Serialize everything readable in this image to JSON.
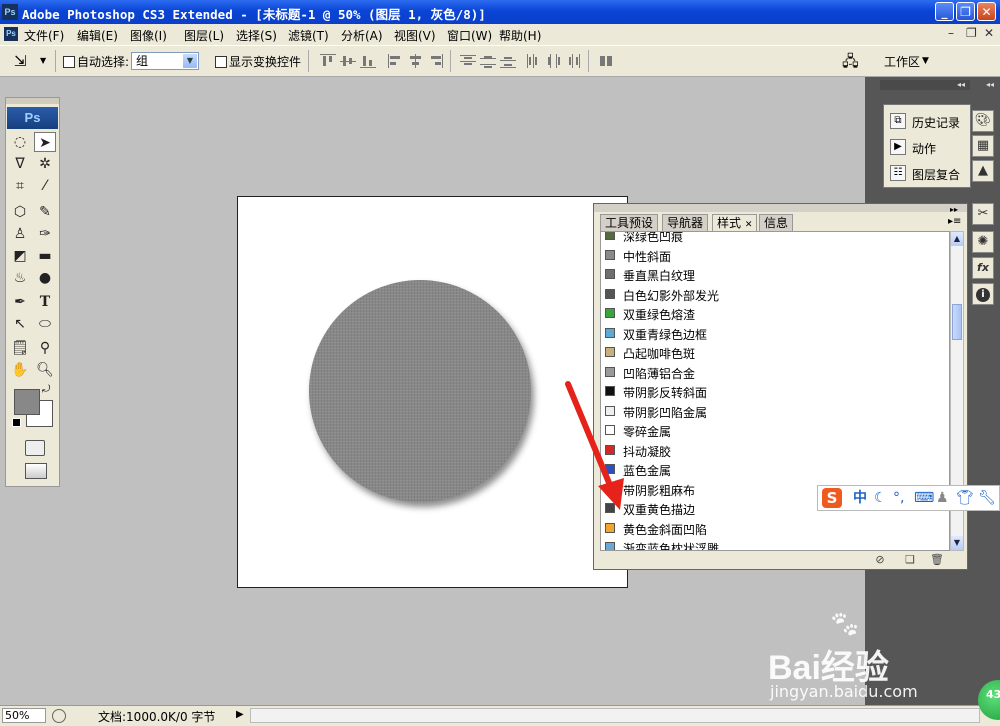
{
  "window": {
    "title": "Adobe Photoshop CS3 Extended - [未标题-1 @ 50% (图层 1, 灰色/8)]",
    "app_icon": "Ps"
  },
  "menubar": {
    "items": [
      "文件(F)",
      "编辑(E)",
      "图像(I)",
      "图层(L)",
      "选择(S)",
      "滤镜(T)",
      "分析(A)",
      "视图(V)",
      "窗口(W)",
      "帮助(H)"
    ]
  },
  "options": {
    "auto_select_label": "自动选择:",
    "auto_select_value": "组",
    "show_transform_label": "显示变换控件",
    "workspace_label": "工作区"
  },
  "toolbox": {
    "logo": "Ps"
  },
  "styles_panel": {
    "tabs": [
      "工具预设",
      "导航器",
      "样式",
      "信息"
    ],
    "active_tab": "样式",
    "items": [
      {
        "label": "深绿色凹痕",
        "color": "#556b3f"
      },
      {
        "label": "中性斜面",
        "color": "#8a8a8a"
      },
      {
        "label": "垂直黑白纹理",
        "color": "#6f6f6f"
      },
      {
        "label": "白色幻影外部发光",
        "color": "#555555"
      },
      {
        "label": "双重绿色熔渣",
        "color": "#3aa53a"
      },
      {
        "label": "双重青绿色边框",
        "color": "#5aa9d6"
      },
      {
        "label": "凸起咖啡色斑",
        "color": "#c9b07a"
      },
      {
        "label": "凹陷薄铝合金",
        "color": "#9a9a9a"
      },
      {
        "label": "带阴影反转斜面",
        "color": "#111111"
      },
      {
        "label": "带阴影凹陷金属",
        "color": "#eeeeee"
      },
      {
        "label": "零碎金属",
        "color": "#ffffff"
      },
      {
        "label": "抖动凝胶",
        "color": "#d42828"
      },
      {
        "label": "蓝色金属",
        "color": "#2d4fc2"
      },
      {
        "label": "带阴影粗麻布",
        "color": "#b8a27a"
      },
      {
        "label": "双重黄色描边",
        "color": "#444444"
      },
      {
        "label": "黄色金斜面凹陷",
        "color": "#f2a62a"
      },
      {
        "label": "渐变蓝色枕状浮雕",
        "color": "#6aa8d8"
      }
    ]
  },
  "history_dock": {
    "items": [
      "历史记录",
      "动作",
      "图层复合"
    ]
  },
  "statusbar": {
    "zoom": "50%",
    "doc_info": "文档:1000.0K/0 字节"
  },
  "ime": {
    "mode": "中"
  },
  "watermark": {
    "brand": "Bai经验",
    "url": "jingyan.baidu.com"
  },
  "badge": "43",
  "colors": {
    "title_bar": "#0a45d6",
    "panel": "#ece9d8",
    "workspace": "#c0c0c0",
    "circle_fill": "#888888",
    "arrow": "#e5231b"
  }
}
